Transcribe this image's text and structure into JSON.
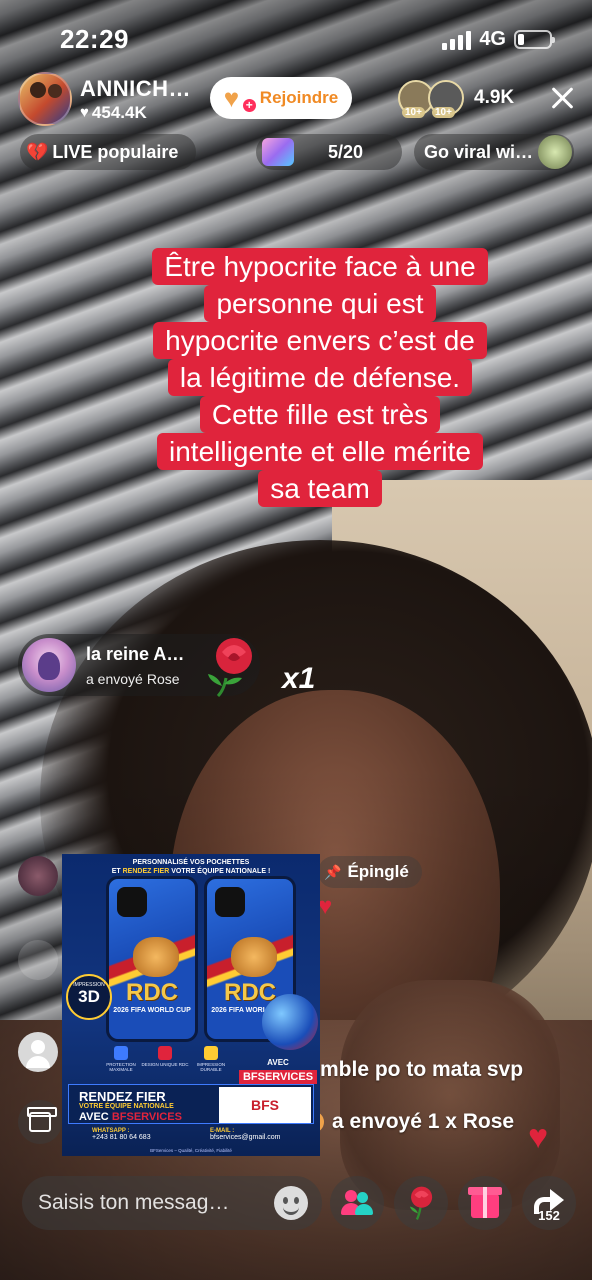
{
  "status_bar": {
    "time": "22:29",
    "network": "4G",
    "battery_level": 0.2
  },
  "host": {
    "name": "ANNICH…",
    "likes": "454.4K",
    "join_label": "Rejoindre"
  },
  "viewers": {
    "badges": [
      "10+",
      "10+"
    ],
    "count": "4.9K"
  },
  "pills": {
    "live_label": "LIVE populaire",
    "rank_label": "5/20",
    "viral_label": "Go viral wi…"
  },
  "caption": {
    "lines": [
      "Être hypocrite face à une",
      "personne qui est",
      "hypocrite envers c’est de",
      "la légitime de défense.",
      "Cette fille est très",
      "intelligente et elle mérite",
      "sa team"
    ]
  },
  "gift_toast": {
    "sender": "la reine A…",
    "action": "a envoyé",
    "gift": "Rose",
    "multiplier": "x1"
  },
  "chat": {
    "pinned_label": "Épinglé",
    "message": "mble po to mata svp",
    "gift_line": "a envoyé 1 x Rose"
  },
  "ad": {
    "header_line1": "PERSONNALISÉ VOS POCHETTES",
    "header_line2_prefix": "ET ",
    "header_line2_highlight": "RENDEZ FIER",
    "header_line2_suffix": " VOTRE ÉQUIPE NATIONALE !",
    "phone_title": "RDC",
    "phone_subtitle": "2026 FIFA WORLD CUP",
    "badge_small": "IMPRESSION",
    "badge_big": "3D",
    "features": [
      "PROTECTION MAXIMALE",
      "DESIGN UNIQUE RDC",
      "IMPRESSION DURABLE"
    ],
    "avec_label": "AVEC",
    "brand": "BFSERVICES",
    "banner_title": "RENDEZ FIER",
    "banner_sub": "VOTRE ÉQUIPE NATIONALE",
    "banner_avec": "AVEC ",
    "banner_brand": "BFSERVICES",
    "logo_text": "BFS",
    "whatsapp_label": "WHATSAPP :",
    "whatsapp": "+243 81 80 64 683",
    "email_label": "E-MAIL :",
    "email": "bfservices@gmail.com",
    "footer": "BFServices – Qualité, Créativité, Fiabilité"
  },
  "bottom_bar": {
    "input_placeholder": "Saisis ton messag…",
    "share_count": "152"
  },
  "icons": {
    "heart": "heart-icon",
    "close": "close-icon",
    "pin": "pin-icon",
    "gift": "gift-icon",
    "rose": "rose-icon",
    "share": "share-icon",
    "emoji": "emoji-icon",
    "people": "multi-guest-icon"
  }
}
